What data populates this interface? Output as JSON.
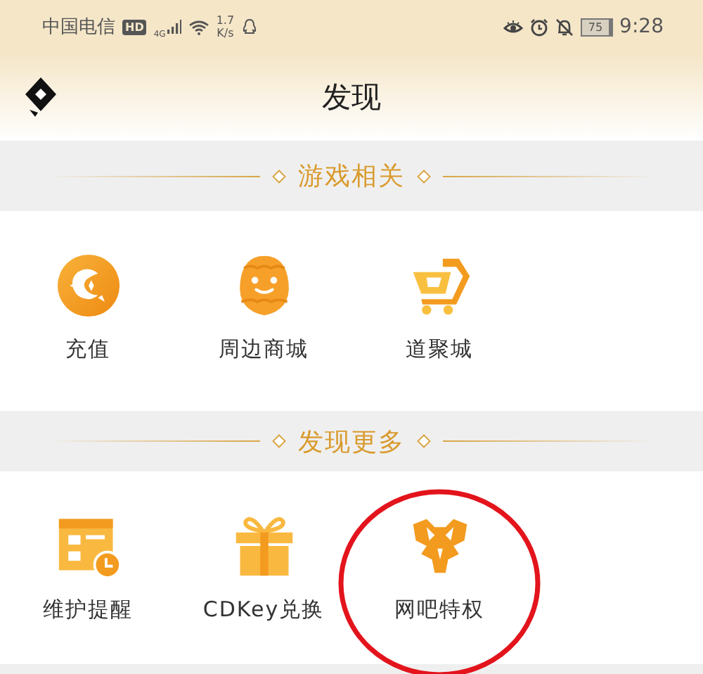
{
  "status_bar": {
    "carrier": "中国电信",
    "hd_badge": "HD",
    "network": "4G",
    "speed_value": "1.7",
    "speed_unit": "K/s",
    "battery": "75",
    "time": "9:28"
  },
  "header": {
    "title": "发现"
  },
  "sections": [
    {
      "title": "游戏相关",
      "items": [
        {
          "kind": "coin",
          "label": "充值",
          "highlighted": false
        },
        {
          "kind": "mascot",
          "label": "周边商城",
          "highlighted": false
        },
        {
          "kind": "cart",
          "label": "道聚城",
          "highlighted": false
        }
      ]
    },
    {
      "title": "发现更多",
      "items": [
        {
          "kind": "calendar",
          "label": "维护提醒",
          "highlighted": false
        },
        {
          "kind": "gift",
          "label": "CDKey兑换",
          "highlighted": false
        },
        {
          "kind": "beast",
          "label": "网吧特权",
          "highlighted": true
        }
      ]
    }
  ]
}
